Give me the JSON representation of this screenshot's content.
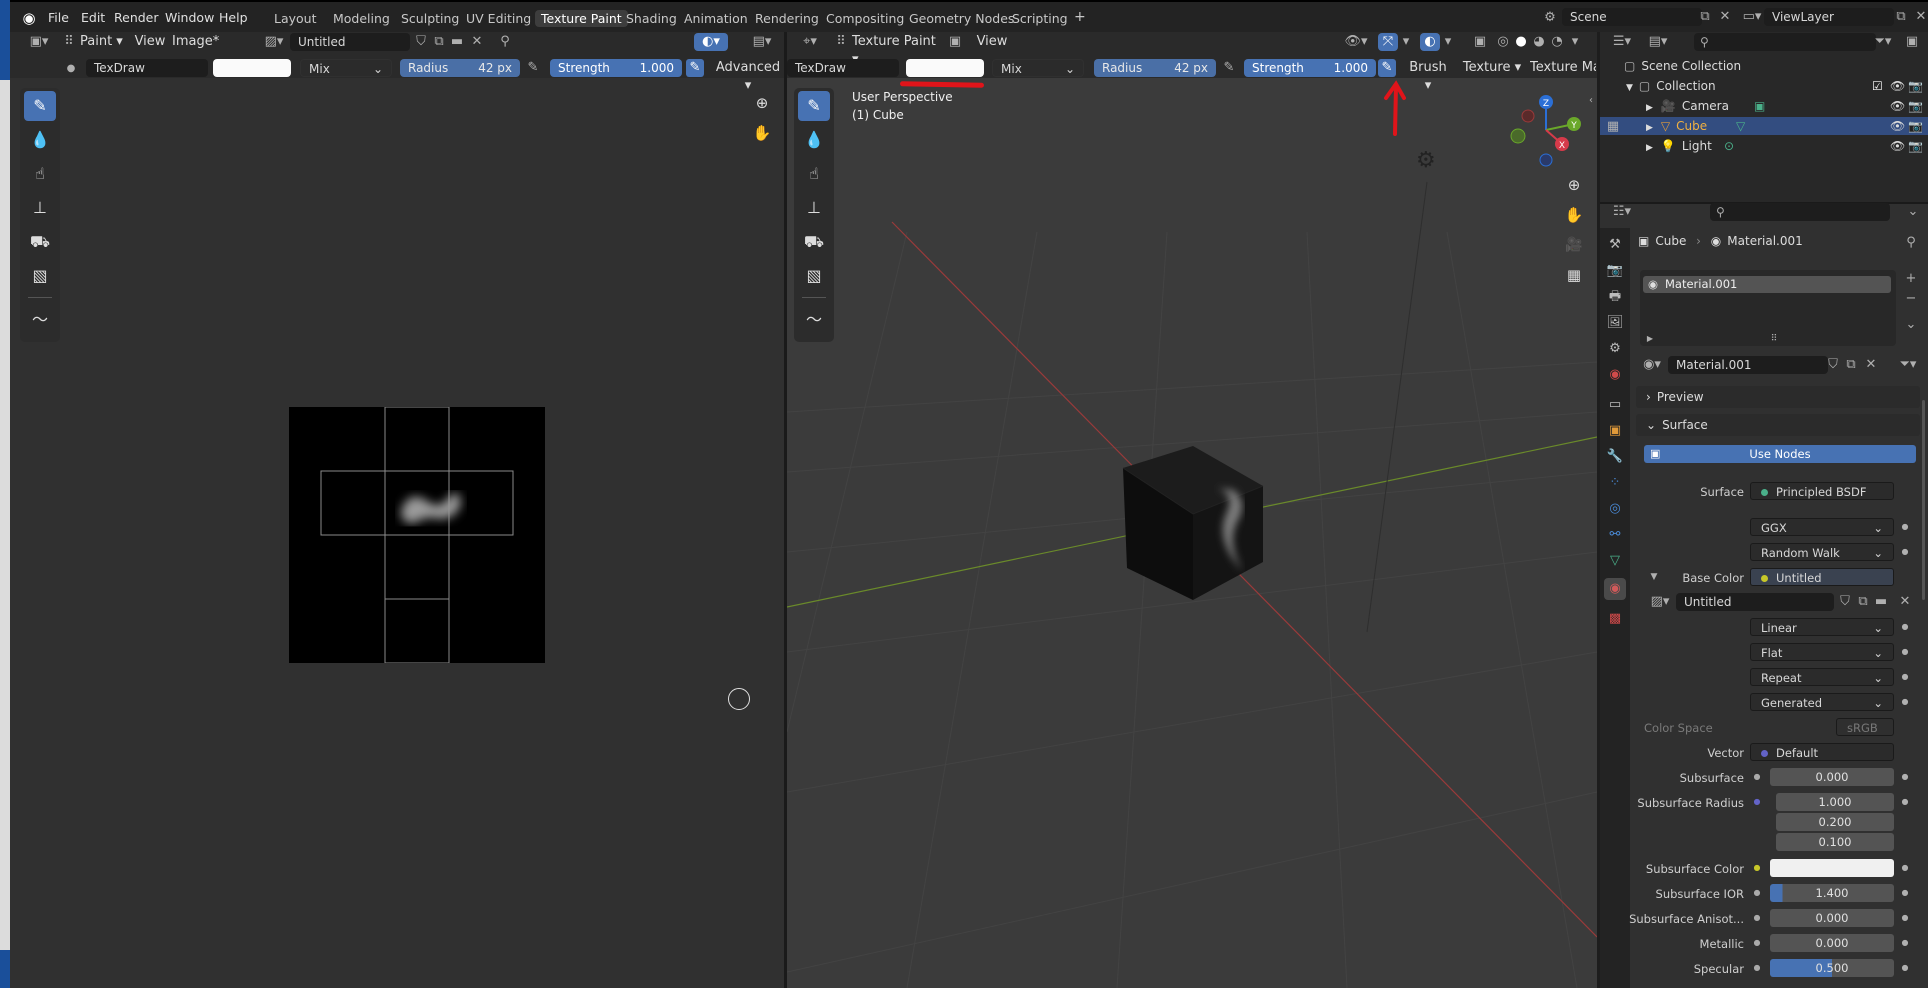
{
  "menubar": {
    "menus": [
      "File",
      "Edit",
      "Render",
      "Window",
      "Help"
    ],
    "workspaces": [
      "Layout",
      "Modeling",
      "Sculpting",
      "UV Editing",
      "Texture Paint",
      "Shading",
      "Animation",
      "Rendering",
      "Compositing",
      "Geometry Nodes",
      "Scripting"
    ],
    "active_workspace": "Texture Paint",
    "add_tab": "+",
    "scene": "Scene",
    "view_layer": "ViewLayer"
  },
  "image_editor": {
    "mode": "Paint",
    "view": "View",
    "image_menu": "Image*",
    "image_name": "Untitled",
    "brush": "TexDraw",
    "blend": "Mix",
    "radius_label": "Radius",
    "radius_value": "42 px",
    "strength_label": "Strength",
    "strength_value": "1.000",
    "advanced": "Advanced"
  },
  "viewport": {
    "mode": "Texture Paint",
    "view": "View",
    "brush": "TexDraw",
    "blend": "Mix",
    "radius_label": "Radius",
    "radius_value": "42 px",
    "strength_label": "Strength",
    "strength_value": "1.000",
    "brush_menu": "Brush",
    "texture_menu": "Texture",
    "texture_mask_menu": "Texture Mas",
    "perspective": "User Perspective",
    "object": "(1) Cube",
    "axes": {
      "x": "X",
      "y": "Y",
      "z": "Z"
    }
  },
  "outliner": {
    "root": "Scene Collection",
    "collection": "Collection",
    "items": [
      "Camera",
      "Cube",
      "Light"
    ],
    "selected": "Cube"
  },
  "properties": {
    "breadcrumb_object": "Cube",
    "breadcrumb_material": "Material.001",
    "slot": "Material.001",
    "material_name": "Material.001",
    "panel_preview": "Preview",
    "panel_surface": "Surface",
    "use_nodes": "Use Nodes",
    "surface_label": "Surface",
    "surface_value": "Principled BSDF",
    "distribution": "GGX",
    "subsurface_method": "Random Walk",
    "base_color_label": "Base Color",
    "base_color_value": "Untitled",
    "image_name": "Untitled",
    "interpolation": "Linear",
    "projection": "Flat",
    "extension": "Repeat",
    "source": "Generated",
    "color_space_label": "Color Space",
    "color_space_value": "sRGB",
    "rows": [
      {
        "label": "Vector",
        "value": "Default",
        "kind": "link"
      },
      {
        "label": "Subsurface",
        "value": "0.000",
        "kind": "num"
      },
      {
        "label": "Subsurface Radius",
        "value": "1.000",
        "kind": "num"
      },
      {
        "label": "",
        "value": "0.200",
        "kind": "num"
      },
      {
        "label": "",
        "value": "0.100",
        "kind": "num"
      },
      {
        "label": "Subsurface Color",
        "value": "",
        "kind": "color"
      },
      {
        "label": "Subsurface IOR",
        "value": "1.400",
        "kind": "num"
      },
      {
        "label": "Subsurface Anisot...",
        "value": "0.000",
        "kind": "num"
      },
      {
        "label": "Metallic",
        "value": "0.000",
        "kind": "num"
      },
      {
        "label": "Specular",
        "value": "0.500",
        "kind": "num"
      }
    ]
  },
  "colors": {
    "accent": "#4772b3",
    "annotation": "#e0141a",
    "header": "#232323",
    "panel": "#303030"
  }
}
